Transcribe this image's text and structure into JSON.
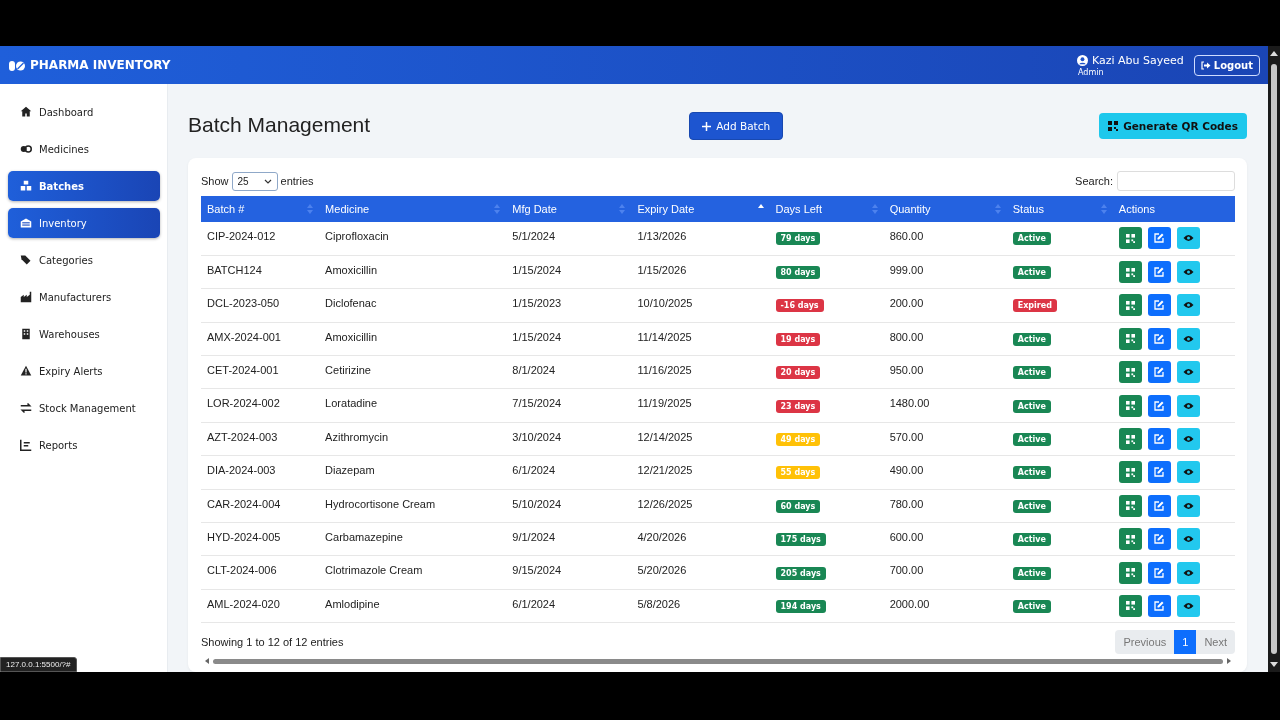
{
  "header": {
    "brand": "PHARMA INVENTORY",
    "user_name": "Kazi Abu Sayeed",
    "user_role": "Admin",
    "logout": "Logout"
  },
  "sidebar": {
    "items": [
      {
        "label": "Dashboard",
        "selected": false,
        "hovered": false
      },
      {
        "label": "Medicines",
        "selected": false,
        "hovered": false
      },
      {
        "label": "Batches",
        "selected": true,
        "hovered": false
      },
      {
        "label": "Inventory",
        "selected": false,
        "hovered": true
      },
      {
        "label": "Categories",
        "selected": false,
        "hovered": false
      },
      {
        "label": "Manufacturers",
        "selected": false,
        "hovered": false
      },
      {
        "label": "Warehouses",
        "selected": false,
        "hovered": false
      },
      {
        "label": "Expiry Alerts",
        "selected": false,
        "hovered": false
      },
      {
        "label": "Stock Management",
        "selected": false,
        "hovered": false
      },
      {
        "label": "Reports",
        "selected": false,
        "hovered": false
      }
    ]
  },
  "page": {
    "title": "Batch Management",
    "add_button": "Add Batch",
    "qr_button": "Generate QR Codes"
  },
  "table_controls": {
    "show_label": "Show",
    "page_size": "25",
    "entries_label": "entries",
    "search_label": "Search:"
  },
  "table": {
    "columns": [
      {
        "label": "Batch #",
        "sortable": true,
        "sorted": false
      },
      {
        "label": "Medicine",
        "sortable": true,
        "sorted": false
      },
      {
        "label": "Mfg Date",
        "sortable": true,
        "sorted": false
      },
      {
        "label": "Expiry Date",
        "sortable": true,
        "sorted": true
      },
      {
        "label": "Days Left",
        "sortable": true,
        "sorted": false
      },
      {
        "label": "Quantity",
        "sortable": true,
        "sorted": false
      },
      {
        "label": "Status",
        "sortable": true,
        "sorted": false
      },
      {
        "label": "Actions",
        "sortable": false,
        "sorted": false
      }
    ],
    "rows": [
      {
        "batch": "CIP-2024-012",
        "medicine": "Ciprofloxacin",
        "mfg": "5/1/2024",
        "expiry": "1/13/2026",
        "days_left": {
          "text": "79 days",
          "color": "#198754"
        },
        "quantity": "860.00",
        "status": {
          "text": "Active",
          "color": "#198754"
        }
      },
      {
        "batch": "BATCH124",
        "medicine": "Amoxicillin",
        "mfg": "1/15/2024",
        "expiry": "1/15/2026",
        "days_left": {
          "text": "80 days",
          "color": "#198754"
        },
        "quantity": "999.00",
        "status": {
          "text": "Active",
          "color": "#198754"
        }
      },
      {
        "batch": "DCL-2023-050",
        "medicine": "Diclofenac",
        "mfg": "1/15/2023",
        "expiry": "10/10/2025",
        "days_left": {
          "text": "-16 days",
          "color": "#dc3545"
        },
        "quantity": "200.00",
        "status": {
          "text": "Expired",
          "color": "#dc3545"
        }
      },
      {
        "batch": "AMX-2024-001",
        "medicine": "Amoxicillin",
        "mfg": "1/15/2024",
        "expiry": "11/14/2025",
        "days_left": {
          "text": "19 days",
          "color": "#dc3545"
        },
        "quantity": "800.00",
        "status": {
          "text": "Active",
          "color": "#198754"
        }
      },
      {
        "batch": "CET-2024-001",
        "medicine": "Cetirizine",
        "mfg": "8/1/2024",
        "expiry": "11/16/2025",
        "days_left": {
          "text": "20 days",
          "color": "#dc3545"
        },
        "quantity": "950.00",
        "status": {
          "text": "Active",
          "color": "#198754"
        }
      },
      {
        "batch": "LOR-2024-002",
        "medicine": "Loratadine",
        "mfg": "7/15/2024",
        "expiry": "11/19/2025",
        "days_left": {
          "text": "23 days",
          "color": "#dc3545"
        },
        "quantity": "1480.00",
        "status": {
          "text": "Active",
          "color": "#198754"
        }
      },
      {
        "batch": "AZT-2024-003",
        "medicine": "Azithromycin",
        "mfg": "3/10/2024",
        "expiry": "12/14/2025",
        "days_left": {
          "text": "49 days",
          "color": "#ffc107"
        },
        "quantity": "570.00",
        "status": {
          "text": "Active",
          "color": "#198754"
        }
      },
      {
        "batch": "DIA-2024-003",
        "medicine": "Diazepam",
        "mfg": "6/1/2024",
        "expiry": "12/21/2025",
        "days_left": {
          "text": "55 days",
          "color": "#ffc107"
        },
        "quantity": "490.00",
        "status": {
          "text": "Active",
          "color": "#198754"
        }
      },
      {
        "batch": "CAR-2024-004",
        "medicine": "Hydrocortisone Cream",
        "mfg": "5/10/2024",
        "expiry": "12/26/2025",
        "days_left": {
          "text": "60 days",
          "color": "#198754"
        },
        "quantity": "780.00",
        "status": {
          "text": "Active",
          "color": "#198754"
        }
      },
      {
        "batch": "HYD-2024-005",
        "medicine": "Carbamazepine",
        "mfg": "9/1/2024",
        "expiry": "4/20/2026",
        "days_left": {
          "text": "175 days",
          "color": "#198754"
        },
        "quantity": "600.00",
        "status": {
          "text": "Active",
          "color": "#198754"
        }
      },
      {
        "batch": "CLT-2024-006",
        "medicine": "Clotrimazole Cream",
        "mfg": "9/15/2024",
        "expiry": "5/20/2026",
        "days_left": {
          "text": "205 days",
          "color": "#198754"
        },
        "quantity": "700.00",
        "status": {
          "text": "Active",
          "color": "#198754"
        }
      },
      {
        "batch": "AML-2024-020",
        "medicine": "Amlodipine",
        "mfg": "6/1/2024",
        "expiry": "5/8/2026",
        "days_left": {
          "text": "194 days",
          "color": "#198754"
        },
        "quantity": "2000.00",
        "status": {
          "text": "Active",
          "color": "#198754"
        }
      }
    ]
  },
  "footer": {
    "info": "Showing 1 to 12 of 12 entries",
    "pagination": [
      {
        "label": "Previous",
        "selected": false
      },
      {
        "label": "1",
        "selected": true
      },
      {
        "label": "Next",
        "selected": false
      }
    ]
  },
  "status_url": "127.0.0.1:5500/?#"
}
